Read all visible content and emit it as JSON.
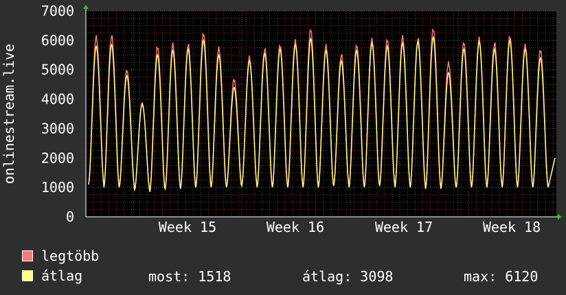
{
  "chart_data": {
    "type": "line",
    "ylabel": "onlinestream.live",
    "ylim": [
      0,
      7000
    ],
    "yticks": [
      0,
      1000,
      2000,
      3000,
      4000,
      5000,
      6000,
      7000
    ],
    "xticks": [
      "Week 15",
      "Week 16",
      "Week 17",
      "Week 18"
    ],
    "daily_peaks_max": [
      6100,
      6150,
      5000,
      3850,
      5750,
      5850,
      5850,
      6250,
      5750,
      4650,
      5400,
      5700,
      5850,
      6000,
      6350,
      5800,
      5500,
      5850,
      6050,
      6000,
      6100,
      6050,
      6400,
      5250,
      5900,
      6050,
      5900,
      6150,
      5850,
      5650
    ],
    "daily_peaks_avg": [
      5800,
      5850,
      4800,
      3850,
      5500,
      5650,
      5700,
      6000,
      5500,
      4400,
      5300,
      5550,
      5700,
      5850,
      6050,
      5650,
      5300,
      5650,
      5900,
      5800,
      5900,
      5950,
      6100,
      4900,
      5700,
      5950,
      5700,
      6000,
      5700,
      5400
    ],
    "daily_troughs": [
      1100,
      1000,
      1000,
      900,
      850,
      950,
      950,
      1000,
      1000,
      1000,
      1050,
      1000,
      1000,
      1000,
      1000,
      1000,
      1050,
      1000,
      1000,
      1050,
      1000,
      1000,
      950,
      950,
      1000,
      1000,
      1000,
      1000,
      1000,
      1000
    ],
    "series": [
      {
        "name": "legtöbb",
        "color": "#f47a7a"
      },
      {
        "name": "átlag",
        "color": "#ffff80"
      }
    ],
    "grid": true
  },
  "legend": {
    "max_label": "legtöbb",
    "avg_label": "átlag"
  },
  "stats": {
    "now": "most: 1518",
    "average": "átlag: 3098",
    "max": "max: 6120"
  },
  "colors": {
    "background": "#2e2e2e",
    "plot_background": "#000000",
    "minor_grid": "#8b2d2d",
    "major_grid": "#606060",
    "axis": "#ffffff",
    "arrow": "#22cc22"
  }
}
